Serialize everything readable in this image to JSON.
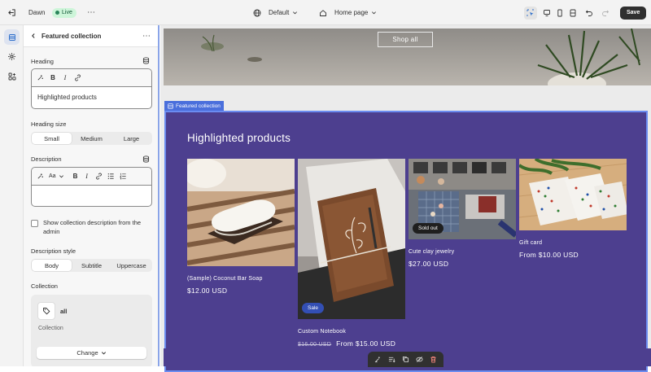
{
  "topbar": {
    "store_name": "Dawn",
    "status": "Live",
    "theme": "Default",
    "page": "Home page",
    "save_label": "Save"
  },
  "panel": {
    "title": "Featured collection",
    "heading_label": "Heading",
    "heading_value": "Highlighted products",
    "heading_size_label": "Heading size",
    "heading_sizes": [
      "Small",
      "Medium",
      "Large"
    ],
    "heading_size_selected": "Small",
    "description_label": "Description",
    "description_value": "",
    "text_style_glyph": "Aa",
    "show_desc_label": "Show collection description from the admin",
    "show_desc_checked": false,
    "desc_style_label": "Description style",
    "desc_styles": [
      "Body",
      "Subtitle",
      "Uppercase"
    ],
    "desc_style_selected": "Body",
    "collection_label": "Collection",
    "collection_name": "all",
    "collection_type": "Collection",
    "change_label": "Change"
  },
  "preview": {
    "shop_all": "Shop all",
    "section_tag": "Featured collection",
    "heading": "Highlighted products",
    "products": [
      {
        "title": "(Sample) Coconut Bar Soap",
        "price": "$12.00 USD",
        "compare": "",
        "badge": ""
      },
      {
        "title": "Custom Notebook",
        "price": "From $15.00 USD",
        "compare": "$16.00 USD",
        "badge": "Sale"
      },
      {
        "title": "Cute clay jewelry",
        "price": "$27.00 USD",
        "compare": "",
        "badge": "Sold out"
      },
      {
        "title": "Gift card",
        "price": "From $10.00 USD",
        "compare": "",
        "badge": ""
      }
    ]
  },
  "colors": {
    "accent": "#4a6fdc",
    "collection_bg": "#4d3f8f",
    "live_green": "#29845a",
    "save_bg": "#303030"
  },
  "icons": {
    "rail": [
      "sections-icon",
      "settings-gear-icon",
      "apps-icon"
    ],
    "toolbar": [
      "inspector-icon",
      "desktop-icon",
      "mobile-icon",
      "fullscreen-icon",
      "undo-icon",
      "redo-icon"
    ],
    "floating": [
      "ai-edit-icon",
      "reorder-icon",
      "duplicate-icon",
      "hide-icon",
      "delete-icon"
    ]
  }
}
